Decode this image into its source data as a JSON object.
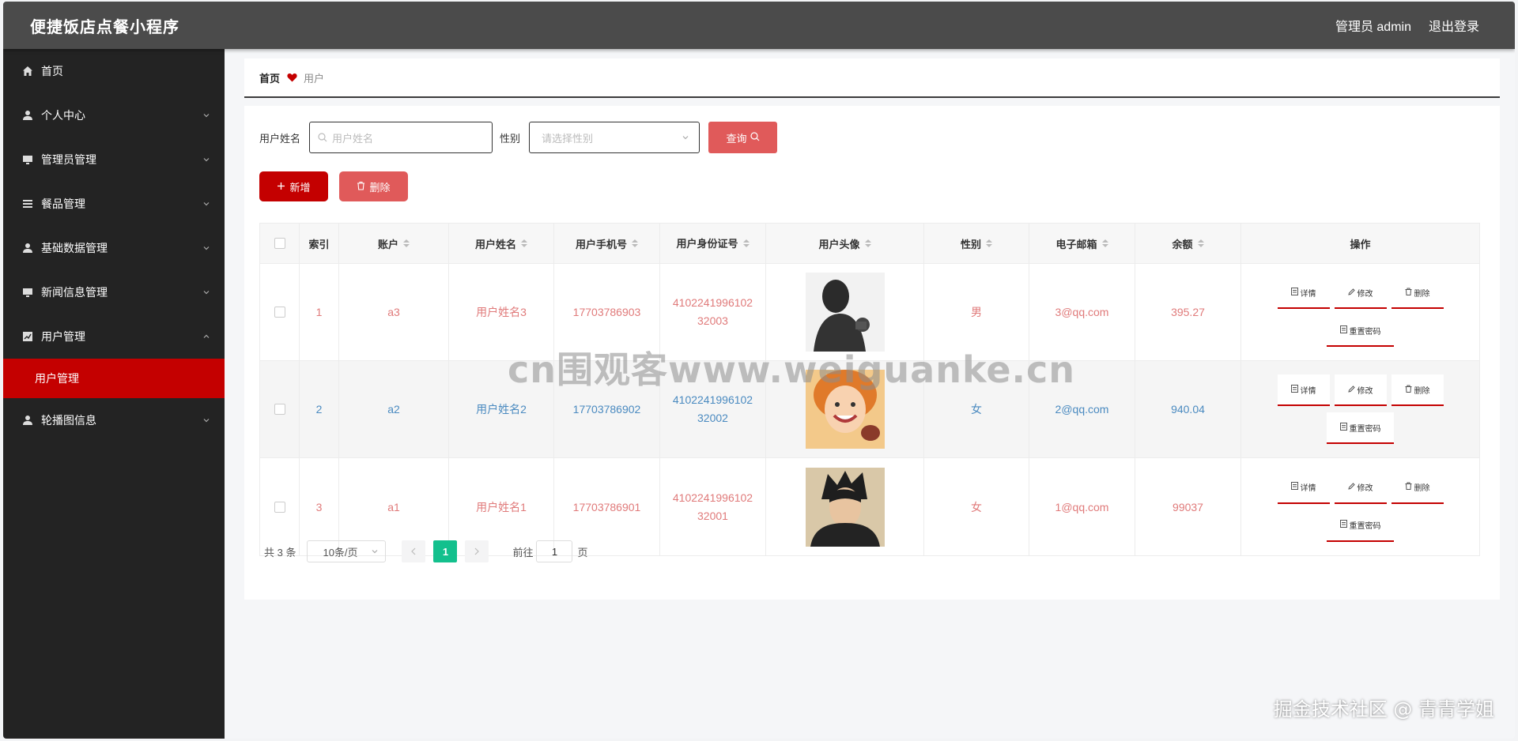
{
  "header": {
    "app_title": "便捷饭店点餐小程序",
    "admin_label": "管理员 admin",
    "logout_label": "退出登录"
  },
  "sidebar": {
    "items": [
      {
        "label": "首页",
        "icon": "home-icon"
      },
      {
        "label": "个人中心",
        "icon": "user-icon"
      },
      {
        "label": "管理员管理",
        "icon": "monitor-icon"
      },
      {
        "label": "餐品管理",
        "icon": "list-icon"
      },
      {
        "label": "基础数据管理",
        "icon": "user-icon"
      },
      {
        "label": "新闻信息管理",
        "icon": "monitor-icon"
      },
      {
        "label": "用户管理",
        "icon": "chart-icon"
      },
      {
        "label": "轮播图信息",
        "icon": "user-icon"
      }
    ],
    "active_sub": "用户管理"
  },
  "breadcrumb": {
    "home": "首页",
    "current": "用户"
  },
  "search": {
    "name_label": "用户姓名",
    "name_placeholder": "用户姓名",
    "sex_label": "性别",
    "sex_placeholder": "请选择性别",
    "query_label": "查询"
  },
  "actions": {
    "add_label": "新增",
    "delete_label": "删除"
  },
  "table": {
    "headers": {
      "index": "索引",
      "account": "账户",
      "name": "用户姓名",
      "phone": "用户手机号",
      "idno": "用户身份证号",
      "avatar": "用户头像",
      "sex": "性别",
      "email": "电子邮箱",
      "balance": "余额",
      "ops": "操作"
    },
    "rows": [
      {
        "index": "1",
        "account": "a3",
        "name": "用户姓名3",
        "phone": "17703786903",
        "idno_1": "4102241996102",
        "idno_2": "32003",
        "sex": "男",
        "email": "3@qq.com",
        "balance": "395.27"
      },
      {
        "index": "2",
        "account": "a2",
        "name": "用户姓名2",
        "phone": "17703786902",
        "idno_1": "4102241996102",
        "idno_2": "32002",
        "sex": "女",
        "email": "2@qq.com",
        "balance": "940.04"
      },
      {
        "index": "3",
        "account": "a1",
        "name": "用户姓名1",
        "phone": "17703786901",
        "idno_1": "4102241996102",
        "idno_2": "32001",
        "sex": "女",
        "email": "1@qq.com",
        "balance": "99037"
      }
    ],
    "ops": {
      "detail": "详情",
      "edit": "修改",
      "delete": "删除",
      "reset": "重置密码"
    }
  },
  "pager": {
    "total": "共 3 条",
    "size": "10条/页",
    "page": "1",
    "goto": "前往",
    "goto_value": "1",
    "page_unit": "页"
  },
  "overlay": {
    "watermark": "cn围观客www.weiguanke.cn",
    "credit": "掘金技术社区 @ 青青学姐"
  },
  "colors": {
    "accent": "#c40000",
    "header_bg": "#4b4b4b",
    "sidebar_bg": "#232323",
    "pager_active": "#13c08d"
  }
}
